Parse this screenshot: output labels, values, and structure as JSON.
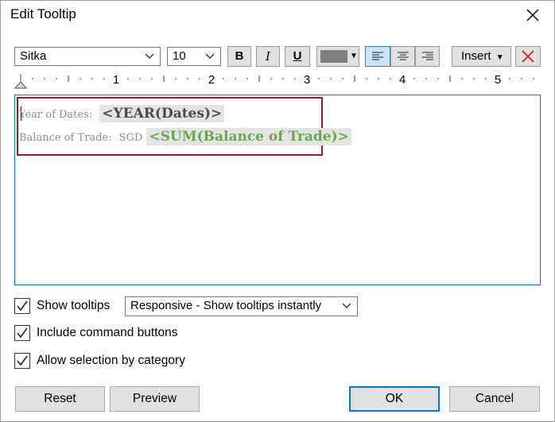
{
  "dialog": {
    "title": "Edit Tooltip"
  },
  "toolbar": {
    "font_family": "Sitka",
    "font_size": "10",
    "bold_label": "B",
    "italic_label": "I",
    "underline_label": "U",
    "text_color": "#7f7f7f",
    "insert_label": "Insert",
    "alignment": "left",
    "clear_icon": "red-x-icon"
  },
  "ruler": {
    "marks": [
      "1",
      "2",
      "3",
      "4",
      "5"
    ]
  },
  "editor": {
    "line1": {
      "label": "Year of Dates:",
      "field": "<YEAR(Dates)>"
    },
    "line2": {
      "label": "Balance of Trade:",
      "prefix": "SGD",
      "field": "<SUM(Balance of Trade)>"
    },
    "highlight_color": "#a01828",
    "field_green": "#6aa84f"
  },
  "options": {
    "show_tooltips": {
      "label": "Show tooltips",
      "checked": true
    },
    "tooltip_mode": "Responsive - Show tooltips instantly",
    "include_command_buttons": {
      "label": "Include command buttons",
      "checked": true
    },
    "allow_selection": {
      "label": "Allow selection by category",
      "checked": true
    }
  },
  "buttons": {
    "reset": "Reset",
    "preview": "Preview",
    "ok": "OK",
    "cancel": "Cancel"
  }
}
